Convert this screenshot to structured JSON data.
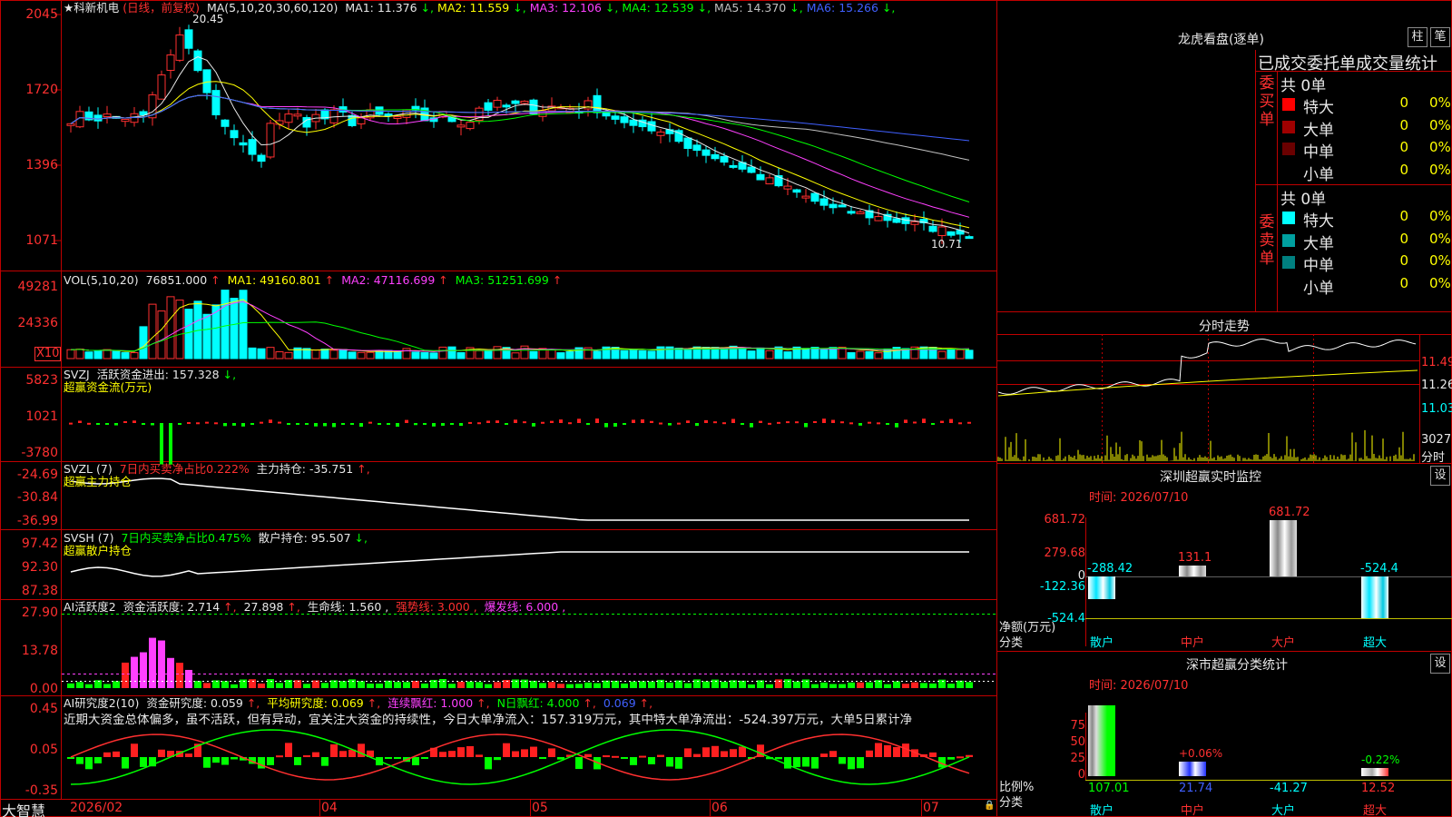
{
  "stock": {
    "name": "★科新机电",
    "period": "(日线，前复权)"
  },
  "main_ma": {
    "prefix": "MA(5,10,20,30,60,120)",
    "items": [
      {
        "label": "MA1: 11.376",
        "color": "#e8e8e8"
      },
      {
        "label": "MA2: 11.559",
        "color": "#ffff00"
      },
      {
        "label": "MA3: 12.106",
        "color": "#ff40ff"
      },
      {
        "label": "MA4: 12.539",
        "color": "#00ff00"
      },
      {
        "label": "MA5: 14.370",
        "color": "#c0c0c0"
      },
      {
        "label": "MA6: 15.266",
        "color": "#4060ff"
      }
    ]
  },
  "price_axis": [
    "2045",
    "1720",
    "1396",
    "1071"
  ],
  "price_high_label": "20.45",
  "price_low_label": "10.71",
  "vol": {
    "prefix": "VOL(5,10,20)",
    "value": "76851.000",
    "ma1": "MA1: 49160.801",
    "ma2": "MA2: 47116.699",
    "ma3": "MA3: 51251.699",
    "axis": [
      "49281",
      "24336"
    ],
    "unit": "X10"
  },
  "svzj": {
    "prefix": "SVZJ",
    "label": "活跃资金进出: 157.328",
    "sub": "超赢资金流(万元)",
    "axis": [
      "5823",
      "1021",
      "-3780"
    ]
  },
  "svzl": {
    "prefix": "SVZL (7)",
    "net": "7日内买卖净占比0.222%",
    "hold": "主力持仓: -35.751",
    "sub": "超赢主力持仓",
    "axis": [
      "-24.69",
      "-30.84",
      "-36.99"
    ]
  },
  "svsh": {
    "prefix": "SVSH (7)",
    "net": "7日内买卖净占比0.475%",
    "hold": "散户持仓: 95.507",
    "sub": "超赢散户持仓",
    "axis": [
      "97.42",
      "92.30",
      "87.38"
    ]
  },
  "ai1": {
    "prefix": "AI活跃度2",
    "act": "资金活跃度: 2.714",
    "v2": "27.898",
    "life": "生命线: 1.560",
    "strong": "强势线: 3.000",
    "burst": "爆发线: 6.000",
    "axis": [
      "27.90",
      "13.78",
      "0.00"
    ]
  },
  "ai2": {
    "prefix": "AI研究度2(10)",
    "res": "资金研究度: 0.059",
    "avg": "平均研究度: 0.069",
    "red": "连续飘红: 1.000",
    "nred": "N日飘红: 4.000",
    "nval": "0.069",
    "comment": "近期大资金总体偏多，虽不活跃，但有异动，宜关注大资金的持续性，今日大单净流入：157.319万元，其中特大单净流出：-524.397万元，大单5日累计净",
    "axis": [
      "0.45",
      "0.05",
      "-0.35"
    ]
  },
  "xaxis": {
    "app": "大智慧",
    "labels": [
      "2026/02",
      "04",
      "05",
      "06",
      "07"
    ]
  },
  "lhb": {
    "title": "龙虎看盘(逐单)",
    "btn1": "柱",
    "btn2": "笔",
    "subtitle": "已成交委托单成交量统计",
    "buy": {
      "side": "委买单",
      "total": "共 0单",
      "rows": [
        {
          "label": "特大",
          "value": "0",
          "pct": "0%",
          "color": "#ff0000"
        },
        {
          "label": "大单",
          "value": "0",
          "pct": "0%",
          "color": "#a00000"
        },
        {
          "label": "中单",
          "value": "0",
          "pct": "0%",
          "color": "#6a0000"
        },
        {
          "label": "小单",
          "value": "0",
          "pct": "0%",
          "color": "#000000"
        }
      ]
    },
    "sell": {
      "side": "委卖单",
      "total": "共 0单",
      "rows": [
        {
          "label": "特大",
          "value": "0",
          "pct": "0%",
          "color": "#00ffff"
        },
        {
          "label": "大单",
          "value": "0",
          "pct": "0%",
          "color": "#00a0a0"
        },
        {
          "label": "中单",
          "value": "0",
          "pct": "0%",
          "color": "#008080"
        },
        {
          "label": "小单",
          "value": "0",
          "pct": "0%",
          "color": "#000000"
        }
      ]
    }
  },
  "intraday": {
    "title": "分时走势",
    "prices": [
      "11.49",
      "11.26",
      "11.03"
    ],
    "vol": "3027",
    "vol_unit": "分时"
  },
  "monitor": {
    "title": "深圳超赢实时监控",
    "btn": "设",
    "time": "时间: 2026/07/10",
    "axis": [
      "681.72",
      "279.68",
      "0",
      "-122.36",
      "-524.4"
    ],
    "unit": "净额(万元)",
    "cat_label": "分类",
    "bars": [
      {
        "cat": "散户",
        "value": -288.42,
        "label": "-288.42"
      },
      {
        "cat": "中户",
        "value": 131.1,
        "label": "131.1"
      },
      {
        "cat": "大户",
        "value": 681.72,
        "label": "681.72"
      },
      {
        "cat": "超大",
        "value": -524.4,
        "label": "-524.4"
      }
    ]
  },
  "classify": {
    "title": "深市超赢分类统计",
    "btn": "设",
    "time": "时间: 2026/07/10",
    "axis": [
      "75",
      "50",
      "25",
      "0"
    ],
    "unit": "比例%",
    "cat_label": "分类",
    "bars": [
      {
        "cat": "散户",
        "pct": "",
        "value": "107.01",
        "h": 100
      },
      {
        "cat": "中户",
        "pct": "+0.06%",
        "value": "21.74",
        "h": 20
      },
      {
        "cat": "大户",
        "pct": "",
        "value": "-41.27",
        "h": 0
      },
      {
        "cat": "超大",
        "pct": "-0.22%",
        "value": "12.52",
        "h": 12
      }
    ]
  }
}
